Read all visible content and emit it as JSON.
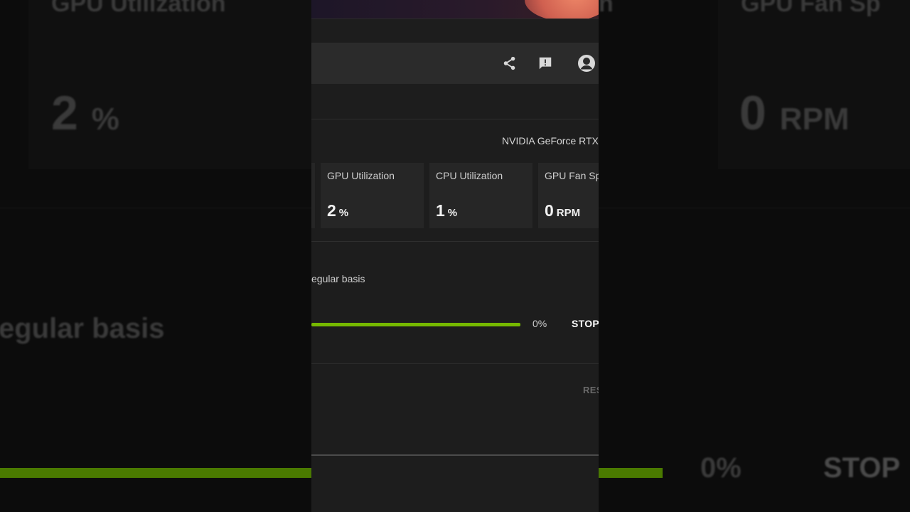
{
  "background": {
    "left_card": {
      "title": "GPU Utilization",
      "value": "2",
      "unit": "%"
    },
    "right_card": {
      "title": "GPU Fan Sp",
      "value": "0",
      "unit": "RPM"
    },
    "mid_card_title_fragment": "n",
    "subtitle_fragment": "egular basis",
    "progress_percent": "0%",
    "stop_label": "STOP"
  },
  "panel": {
    "toolbar": {
      "share_icon": "share-icon",
      "feedback_icon": "feedback-icon",
      "profile_icon": "profile-icon"
    },
    "gpu_name": "NVIDIA GeForce RTX",
    "stats": [
      {
        "title": "GPU Utilization",
        "value": "2",
        "unit": "%"
      },
      {
        "title": "CPU Utilization",
        "value": "1",
        "unit": "%"
      },
      {
        "title": "GPU Fan Sp",
        "value": "0",
        "unit": "RPM"
      }
    ],
    "description_fragment": "egular basis",
    "progress": {
      "fraction": 1.0,
      "label": "0%",
      "color": "#76b900"
    },
    "stop_label": "STOP",
    "reset_label": "RES"
  },
  "colors": {
    "accent_green": "#76b900",
    "panel_bg": "#1d1d1d",
    "card_bg": "#262626",
    "toolbar_bg": "#2b2b2b"
  }
}
